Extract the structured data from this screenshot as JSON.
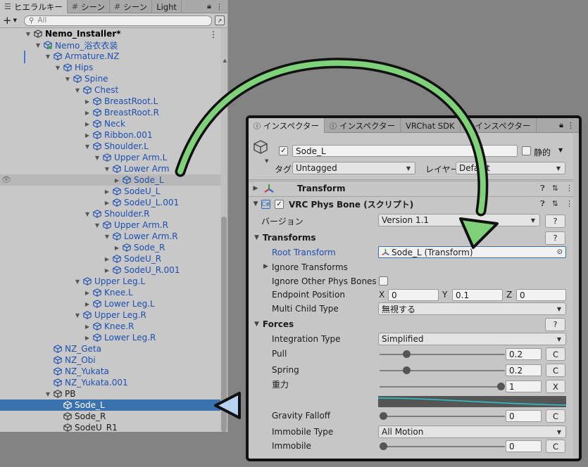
{
  "hierarchy": {
    "tabs": [
      {
        "label": "ヒエラルキー",
        "active": true
      },
      {
        "label": "シーン"
      },
      {
        "label": "シーン"
      },
      {
        "label": "Light"
      }
    ],
    "search_placeholder": "All",
    "items": [
      {
        "label": "Nemo_Installer*",
        "depth": 0,
        "arrow": "open",
        "icon": "unity-scene-icon",
        "style": "bold"
      },
      {
        "label": "Nemo_浴衣衣装",
        "depth": 1,
        "arrow": "open",
        "icon": "prefab-icon",
        "style": "blue"
      },
      {
        "label": "Armature.NZ",
        "depth": 2,
        "arrow": "open",
        "icon": "cube-icon",
        "style": "blue"
      },
      {
        "label": "Hips",
        "depth": 3,
        "arrow": "open",
        "icon": "cube-icon",
        "style": "blue"
      },
      {
        "label": "Spine",
        "depth": 4,
        "arrow": "open",
        "icon": "cube-icon",
        "style": "blue"
      },
      {
        "label": "Chest",
        "depth": 5,
        "arrow": "open",
        "icon": "cube-icon",
        "style": "blue"
      },
      {
        "label": "BreastRoot.L",
        "depth": 6,
        "arrow": "closed",
        "icon": "cube-icon",
        "style": "blue"
      },
      {
        "label": "BreastRoot.R",
        "depth": 6,
        "arrow": "closed",
        "icon": "cube-icon",
        "style": "blue"
      },
      {
        "label": "Neck",
        "depth": 6,
        "arrow": "closed",
        "icon": "cube-icon",
        "style": "blue"
      },
      {
        "label": "Ribbon.001",
        "depth": 6,
        "arrow": "closed",
        "icon": "cube-icon",
        "style": "blue"
      },
      {
        "label": "Shoulder.L",
        "depth": 6,
        "arrow": "open",
        "icon": "cube-icon",
        "style": "blue"
      },
      {
        "label": "Upper Arm.L",
        "depth": 7,
        "arrow": "open",
        "icon": "cube-icon",
        "style": "blue"
      },
      {
        "label": "Lower Arm",
        "depth": 8,
        "arrow": "open",
        "icon": "cube-icon",
        "style": "blue"
      },
      {
        "label": "Sode_L",
        "depth": 9,
        "arrow": "closed",
        "icon": "cube-icon",
        "style": "blue",
        "hover": true
      },
      {
        "label": "SodeU_L",
        "depth": 8,
        "arrow": "closed",
        "icon": "cube-icon",
        "style": "blue"
      },
      {
        "label": "SodeU_L.001",
        "depth": 8,
        "arrow": "closed",
        "icon": "cube-icon",
        "style": "blue"
      },
      {
        "label": "Shoulder.R",
        "depth": 6,
        "arrow": "open",
        "icon": "cube-icon",
        "style": "blue"
      },
      {
        "label": "Upper Arm.R",
        "depth": 7,
        "arrow": "open",
        "icon": "cube-icon",
        "style": "blue"
      },
      {
        "label": "Lower Arm.R",
        "depth": 8,
        "arrow": "open",
        "icon": "cube-icon",
        "style": "blue"
      },
      {
        "label": "Sode_R",
        "depth": 9,
        "arrow": "closed",
        "icon": "cube-icon",
        "style": "blue"
      },
      {
        "label": "SodeU_R",
        "depth": 8,
        "arrow": "closed",
        "icon": "cube-icon",
        "style": "blue"
      },
      {
        "label": "SodeU_R.001",
        "depth": 8,
        "arrow": "closed",
        "icon": "cube-icon",
        "style": "blue"
      },
      {
        "label": "Upper Leg.L",
        "depth": 5,
        "arrow": "open",
        "icon": "cube-icon",
        "style": "blue"
      },
      {
        "label": "Knee.L",
        "depth": 6,
        "arrow": "closed",
        "icon": "cube-icon",
        "style": "blue"
      },
      {
        "label": "Lower Leg.L",
        "depth": 6,
        "arrow": "closed",
        "icon": "cube-icon",
        "style": "blue"
      },
      {
        "label": "Upper Leg.R",
        "depth": 5,
        "arrow": "open",
        "icon": "cube-icon",
        "style": "blue"
      },
      {
        "label": "Knee.R",
        "depth": 6,
        "arrow": "closed",
        "icon": "cube-icon",
        "style": "blue"
      },
      {
        "label": "Lower Leg.R",
        "depth": 6,
        "arrow": "closed",
        "icon": "cube-icon",
        "style": "blue"
      },
      {
        "label": "NZ_Geta",
        "depth": 2,
        "arrow": "none",
        "icon": "cube-icon",
        "style": "blue"
      },
      {
        "label": "NZ_Obi",
        "depth": 2,
        "arrow": "none",
        "icon": "cube-icon",
        "style": "blue"
      },
      {
        "label": "NZ_Yukata",
        "depth": 2,
        "arrow": "none",
        "icon": "cube-icon",
        "style": "blue"
      },
      {
        "label": "NZ_Yukata.001",
        "depth": 2,
        "arrow": "none",
        "icon": "cube-icon",
        "style": "blue"
      },
      {
        "label": "PB",
        "depth": 2,
        "arrow": "open",
        "icon": "cube-icon",
        "style": "normal"
      },
      {
        "label": "Sode_L",
        "depth": 3,
        "arrow": "none",
        "icon": "cube-icon",
        "style": "normal",
        "selected": true
      },
      {
        "label": "Sode_R",
        "depth": 3,
        "arrow": "none",
        "icon": "cube-icon",
        "style": "normal"
      },
      {
        "label": "SodeU_R1",
        "depth": 3,
        "arrow": "none",
        "icon": "cube-icon",
        "style": "normal"
      }
    ]
  },
  "inspector": {
    "tabs": [
      {
        "label": "インスペクター",
        "active": true
      },
      {
        "label": "インスペクター"
      },
      {
        "label": "VRChat SDK"
      },
      {
        "label": "インスペクター"
      }
    ],
    "object_name": "Sode_L",
    "static_label": "静的",
    "tag_label": "タグ",
    "tag_value": "Untagged",
    "layer_label": "レイヤー",
    "layer_value": "Default",
    "transform_title": "Transform",
    "physbone_title": "VRC Phys Bone (スクリプト)",
    "version_label": "バージョン",
    "version_value": "Version 1.1",
    "help_label": "?",
    "transforms_section": "Transforms",
    "root_transform_label": "Root Transform",
    "root_transform_value": "Sode_L (Transform)",
    "ignore_transforms_label": "Ignore Transforms",
    "ignore_other_label": "Ignore Other Phys Bones",
    "endpoint_label": "Endpoint Position",
    "endpoint": {
      "x_label": "X",
      "x": "0",
      "y_label": "Y",
      "y": "0.1",
      "z_label": "Z",
      "z": "0"
    },
    "multi_child_label": "Multi Child Type",
    "multi_child_value": "無視する",
    "forces_section": "Forces",
    "integration_label": "Integration Type",
    "integration_value": "Simplified",
    "pull_label": "Pull",
    "pull_value": "0.2",
    "spring_label": "Spring",
    "spring_value": "0.2",
    "gravity_label": "重力",
    "gravity_value": "1",
    "gravity_falloff_label": "Gravity Falloff",
    "gravity_falloff_value": "0",
    "immobile_type_label": "Immobile Type",
    "immobile_type_value": "All Motion",
    "immobile_label": "Immobile",
    "immobile_value": "0",
    "curve_button": "C",
    "clear_button": "X"
  },
  "colors": {
    "selection": "#3a72b0",
    "arrow_green": "#7fd17a",
    "pointer_blue": "#b8d2f2",
    "curve_cyan": "#2bc4cf"
  }
}
